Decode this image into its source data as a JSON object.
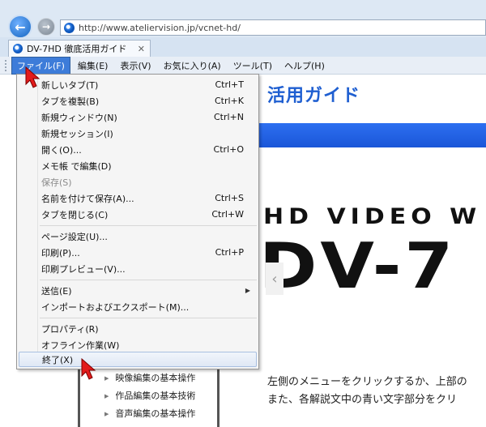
{
  "browser": {
    "url": "http://www.ateliervision.jp/vcnet-hd/",
    "tab_title": "DV-7HD 徹底活用ガイド"
  },
  "menubar": {
    "items": [
      {
        "label": "ファイル(F)"
      },
      {
        "label": "編集(E)"
      },
      {
        "label": "表示(V)"
      },
      {
        "label": "お気に入り(A)"
      },
      {
        "label": "ツール(T)"
      },
      {
        "label": "ヘルプ(H)"
      }
    ]
  },
  "file_menu": {
    "items": [
      {
        "label": "新しいタブ(T)",
        "shortcut": "Ctrl+T"
      },
      {
        "label": "タブを複製(B)",
        "shortcut": "Ctrl+K"
      },
      {
        "label": "新規ウィンドウ(N)",
        "shortcut": "Ctrl+N"
      },
      {
        "label": "新規セッション(I)",
        "shortcut": ""
      },
      {
        "label": "開く(O)...",
        "shortcut": "Ctrl+O"
      },
      {
        "label": "メモ帳 で編集(D)",
        "shortcut": ""
      },
      {
        "label": "保存(S)",
        "shortcut": ""
      },
      {
        "label": "名前を付けて保存(A)...",
        "shortcut": "Ctrl+S"
      },
      {
        "label": "タブを閉じる(C)",
        "shortcut": "Ctrl+W"
      },
      {
        "label": "ページ設定(U)...",
        "shortcut": ""
      },
      {
        "label": "印刷(P)...",
        "shortcut": "Ctrl+P"
      },
      {
        "label": "印刷プレビュー(V)...",
        "shortcut": ""
      },
      {
        "label": "送信(E)",
        "shortcut": ""
      },
      {
        "label": "インポートおよびエクスポート(M)...",
        "shortcut": ""
      },
      {
        "label": "プロパティ(R)",
        "shortcut": ""
      },
      {
        "label": "オフライン作業(W)",
        "shortcut": ""
      },
      {
        "label": "終了(X)",
        "shortcut": ""
      }
    ]
  },
  "page": {
    "title_fragment": "活用ガイド",
    "hero_line1": "HD VIDEO W",
    "hero_line2": "DV-7",
    "body_line1": "左側のメニューをクリックするか、上部の",
    "body_line2": "また、各解説文中の青い文字部分をクリ",
    "side_items": [
      "映像編集の基本操作",
      "作品編集の基本技術",
      "音声編集の基本操作"
    ]
  },
  "colors": {
    "menu_active": "#3d7cd9",
    "page_blue": "#1f5fd1",
    "cursor_red": "#e21b1b"
  }
}
